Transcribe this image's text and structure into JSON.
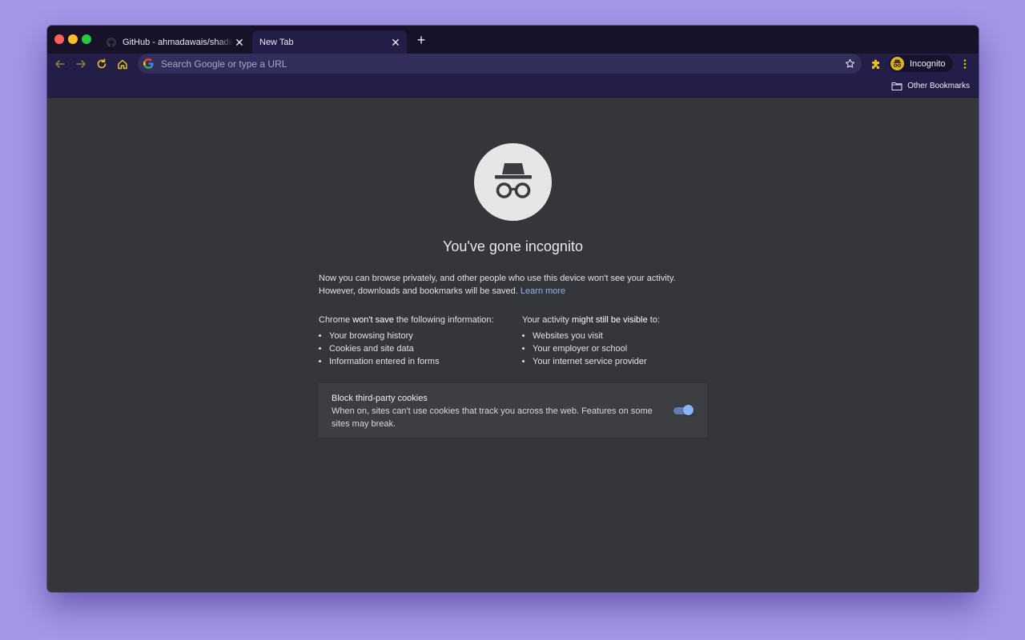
{
  "tabs": [
    {
      "title": "GitHub - ahmadawais/shades-of-purple",
      "favicon": "github-icon",
      "active": false
    },
    {
      "title": "New Tab",
      "favicon": "",
      "active": true
    }
  ],
  "toolbar": {
    "omnibox_placeholder": "Search Google or type a URL",
    "profile_label": "Incognito"
  },
  "bookmarks": {
    "other_label": "Other Bookmarks"
  },
  "incognito": {
    "heading": "You've gone incognito",
    "intro": "Now you can browse privately, and other people who use this device won't see your activity. However, downloads and bookmarks will be saved.",
    "learn_more": "Learn more",
    "left_prefix": "Chrome ",
    "left_bold": "won't save",
    "left_suffix": " the following information:",
    "left_items": [
      "Your browsing history",
      "Cookies and site data",
      "Information entered in forms"
    ],
    "right_prefix": "Your activity ",
    "right_bold": "might still be visible",
    "right_suffix": " to:",
    "right_items": [
      "Websites you visit",
      "Your employer or school",
      "Your internet service provider"
    ],
    "cookie_title": "Block third-party cookies",
    "cookie_desc": "When on, sites can't use cookies that track you across the web. Features on some sites may break.",
    "cookie_toggle_on": true
  },
  "colors": {
    "tabstrip": "#171228",
    "toolbar": "#221e47",
    "content": "#35363a",
    "accent_yellow": "#e9c11d",
    "link": "#8ab4f8"
  }
}
